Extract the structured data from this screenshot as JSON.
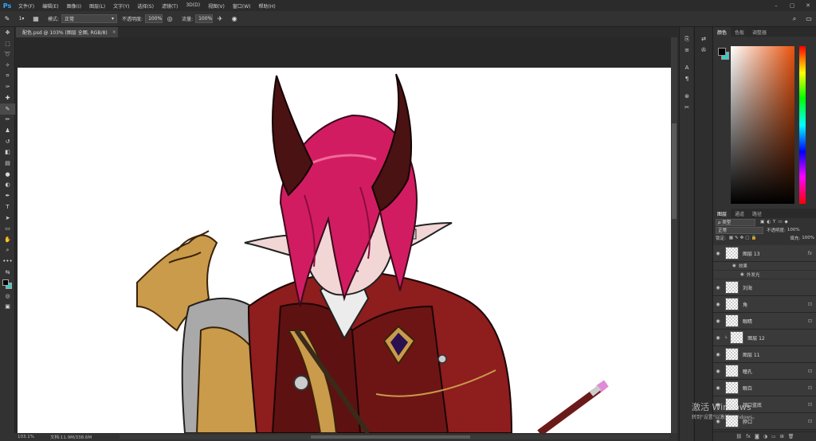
{
  "app": {
    "logo": "Ps"
  },
  "menu": [
    "文件(F)",
    "编辑(E)",
    "图像(I)",
    "图层(L)",
    "文字(Y)",
    "选择(S)",
    "滤镜(T)",
    "3D(D)",
    "视图(V)",
    "窗口(W)",
    "帮助(H)"
  ],
  "window_controls": [
    "–",
    "▢",
    "✕"
  ],
  "options": {
    "size": "1",
    "mode_label": "模式:",
    "mode_value": "正常",
    "opacity_label": "不透明度:",
    "opacity_value": "100%",
    "flow_label": "流量:",
    "flow_value": "100%"
  },
  "document": {
    "tab_title": "配色.psd @ 103% (图层 全图, RGB/8)",
    "close": "×"
  },
  "status": {
    "zoom": "103.1%",
    "doc_info": "文档:11.9M/338.6M"
  },
  "panels": {
    "color_tabs": [
      "颜色",
      "色板",
      "调整器"
    ],
    "layers_tabs": [
      "图层",
      "通道",
      "路径"
    ],
    "kind_filter": "ρ 类型",
    "blend_mode": "正常",
    "opacity_label": "不透明度:",
    "opacity_value": "100%",
    "lock_label": "锁定:",
    "fill_label": "填充:",
    "fill_value": "100%",
    "foreground_color": "#000000",
    "background_color": "#3cc9c0"
  },
  "layers": [
    {
      "name": "图层 13",
      "badge": "fx",
      "effects": [
        "效果",
        "外发光"
      ]
    },
    {
      "name": "刘海",
      "badge": ""
    },
    {
      "name": "角",
      "badge": "lock"
    },
    {
      "name": "眼睛",
      "badge": "lock"
    },
    {
      "name": "图层 12",
      "badge": "",
      "clipped": true
    },
    {
      "name": "图层 11",
      "badge": ""
    },
    {
      "name": "瞳孔",
      "badge": "lock"
    },
    {
      "name": "眼白",
      "badge": "lock"
    },
    {
      "name": "领口蓝底",
      "badge": "lock"
    },
    {
      "name": "脖口",
      "badge": "lock"
    }
  ],
  "watermark": {
    "line1": "激活 Windows",
    "line2": "转到\"设置\"以激活 Windows。"
  },
  "colors": {
    "accent": "#31a8ff",
    "hair": "#d21c62",
    "horn": "#4a1212",
    "coat": "#8e1d1d",
    "armor": "#c99b4a"
  }
}
